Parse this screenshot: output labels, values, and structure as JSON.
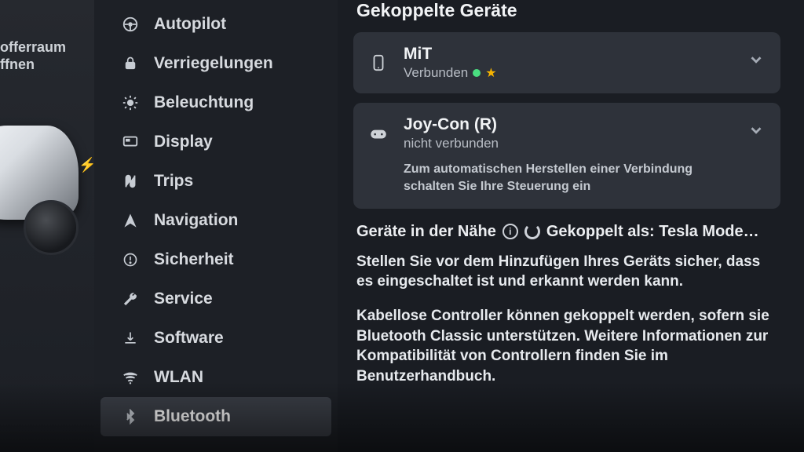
{
  "car_panel": {
    "trunk_line1": "offerraum",
    "trunk_line2": "ffnen"
  },
  "sidebar": {
    "items": [
      {
        "icon": "steering-wheel-icon",
        "label": "Autopilot"
      },
      {
        "icon": "lock-icon",
        "label": "Verriegelungen"
      },
      {
        "icon": "light-icon",
        "label": "Beleuchtung"
      },
      {
        "icon": "display-icon",
        "label": "Display"
      },
      {
        "icon": "trips-icon",
        "label": "Trips"
      },
      {
        "icon": "navigation-icon",
        "label": "Navigation"
      },
      {
        "icon": "safety-icon",
        "label": "Sicherheit"
      },
      {
        "icon": "service-icon",
        "label": "Service"
      },
      {
        "icon": "software-icon",
        "label": "Software"
      },
      {
        "icon": "wifi-icon",
        "label": "WLAN"
      },
      {
        "icon": "bluetooth-icon",
        "label": "Bluetooth",
        "selected": true
      }
    ]
  },
  "main": {
    "paired_title": "Gekoppelte Geräte",
    "devices": [
      {
        "icon": "phone-icon",
        "name": "MiT",
        "status": "Verbunden",
        "connected": true,
        "favorite": true
      },
      {
        "icon": "gamepad-icon",
        "name": "Joy-Con (R)",
        "status": "nicht verbunden",
        "connected": false,
        "hint": "Zum automatischen Herstellen einer Verbindung schalten Sie Ihre Steuerung ein"
      }
    ],
    "nearby_label": "Geräte in der Nähe",
    "paired_as_prefix": "Gekoppelt als:",
    "paired_as_name": "Tesla Mode…",
    "help1": "Stellen Sie vor dem Hinzufügen Ihres Geräts sicher, dass es eingeschaltet ist und erkannt werden kann.",
    "help2": "Kabellose Controller können gekoppelt werden, sofern sie Bluetooth Classic unterstützen. Weitere Informationen zur Kompatibilität von Controllern finden Sie im Benutzerhandbuch."
  }
}
